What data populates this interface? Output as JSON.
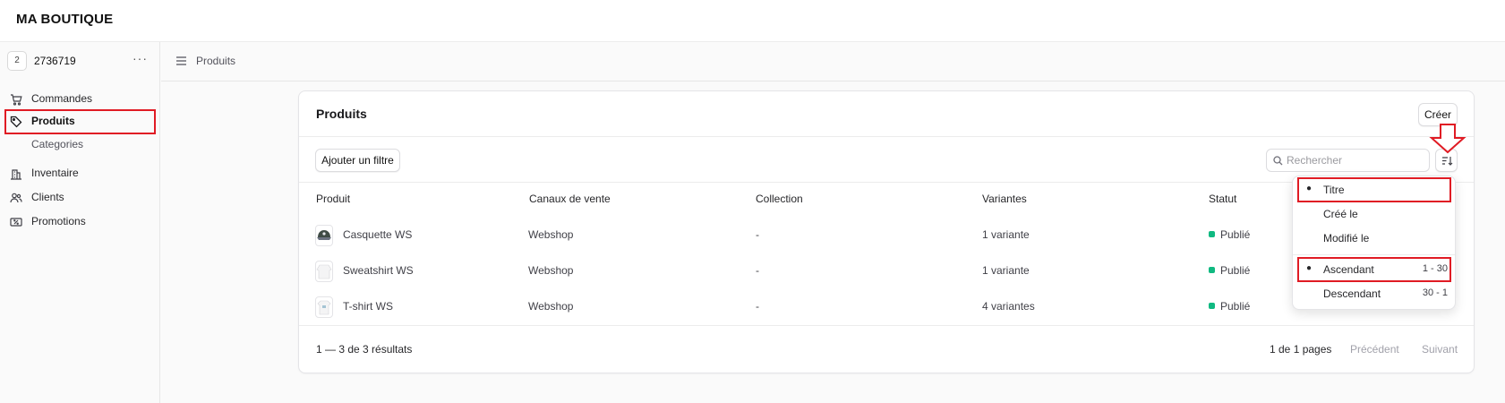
{
  "app": {
    "brand": "MA BOUTIQUE"
  },
  "store": {
    "badge": "2",
    "name": "2736719",
    "more": "···"
  },
  "sidebar": {
    "items": [
      {
        "label": "Commandes",
        "icon": "cart-icon"
      },
      {
        "label": "Produits",
        "icon": "tag-icon",
        "active": true
      },
      {
        "label": "Categories",
        "sub": true
      },
      {
        "label": "Inventaire",
        "icon": "building-icon"
      },
      {
        "label": "Clients",
        "icon": "users-icon"
      },
      {
        "label": "Promotions",
        "icon": "ticket-icon"
      }
    ]
  },
  "breadcrumb": {
    "label": "Produits"
  },
  "main": {
    "title": "Produits",
    "create_label": "Créer",
    "filter_label": "Ajouter un filtre",
    "search": {
      "placeholder": "Rechercher",
      "value": ""
    },
    "columns": [
      "Produit",
      "Canaux de vente",
      "Collection",
      "Variantes",
      "Statut"
    ],
    "rows": [
      {
        "name": "Casquette WS",
        "channel": "Webshop",
        "collection": "-",
        "variants": "1 variante",
        "status": "Publié"
      },
      {
        "name": "Sweatshirt WS",
        "channel": "Webshop",
        "collection": "-",
        "variants": "1 variante",
        "status": "Publié"
      },
      {
        "name": "T-shirt WS",
        "channel": "Webshop",
        "collection": "-",
        "variants": "4 variantes",
        "status": "Publié"
      }
    ],
    "footer": {
      "results": "1 — 3 de 3 résultats",
      "pages": "1 de 1 pages",
      "prev": "Précédent",
      "next": "Suivant"
    }
  },
  "sort_menu": {
    "fields": [
      {
        "label": "Titre",
        "selected": true
      },
      {
        "label": "Créé le",
        "selected": false
      },
      {
        "label": "Modifié le",
        "selected": false
      }
    ],
    "orders": [
      {
        "label": "Ascendant",
        "range": "1 - 30",
        "selected": true
      },
      {
        "label": "Descendant",
        "range": "30 - 1",
        "selected": false
      }
    ]
  },
  "colors": {
    "status_published": "#10b981",
    "annotation": "#e01b24"
  }
}
